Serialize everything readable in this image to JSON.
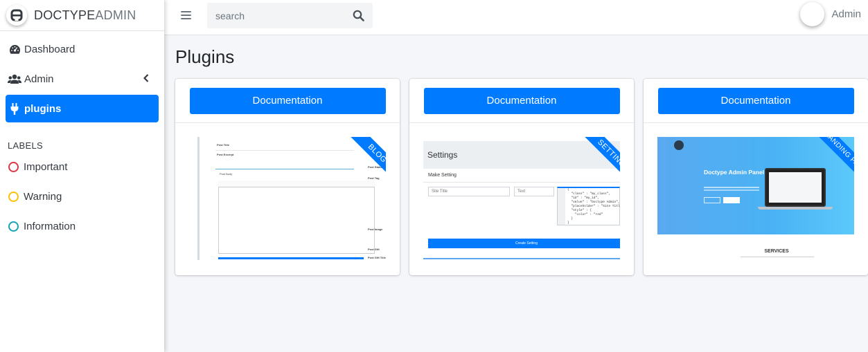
{
  "brand": {
    "bold": "DOCTYPE",
    "light": "ADMIN"
  },
  "search": {
    "placeholder": "search"
  },
  "user": {
    "name": "Admin"
  },
  "sidebar": {
    "items": [
      {
        "label": "Dashboard",
        "icon": "dashboard-icon"
      },
      {
        "label": "Admin",
        "icon": "users-icon",
        "has_children": true
      },
      {
        "label": "plugins",
        "icon": "plug-icon",
        "active": true
      }
    ],
    "labels_header": "LABELS",
    "labels": [
      {
        "label": "Important",
        "color": "#dc3545"
      },
      {
        "label": "Warning",
        "color": "#ffc107"
      },
      {
        "label": "Information",
        "color": "#17a2b8"
      }
    ]
  },
  "page": {
    "title": "Plugins"
  },
  "cards": [
    {
      "button": "Documentation",
      "ribbon": "BLOG",
      "thumb": {
        "labels": [
          "Post Title",
          "Post Excerpt",
          "Post Body",
          "Post Status",
          "Post Tag",
          "Post Image",
          "Post Gift",
          "Post Gift Title"
        ]
      }
    },
    {
      "button": "Documentation",
      "ribbon": "SETTING",
      "thumb": {
        "title": "Settings",
        "subtitle": "Make Setting",
        "field1": "Site Title",
        "field2": "Text",
        "code": "{\n  \"class\" : \"my_class\",\n  \"id\" : \"my_id\",\n  \"value\" : \"Doctype Admin\",\n  \"placeholder\" : \"Site Titl\n  \"style\" : {\n    \"color\" : \"red\"\n  }\n}",
        "button": "Create Setting"
      }
    },
    {
      "button": "Documentation",
      "ribbon": "LANDING PAGE",
      "thumb": {
        "hero_title": "Doctype Admin Panel",
        "section": "SERVICES"
      }
    }
  ],
  "colors": {
    "primary": "#007bff",
    "sidebar_bg": "#ffffff",
    "content_bg": "#f4f6f9"
  }
}
